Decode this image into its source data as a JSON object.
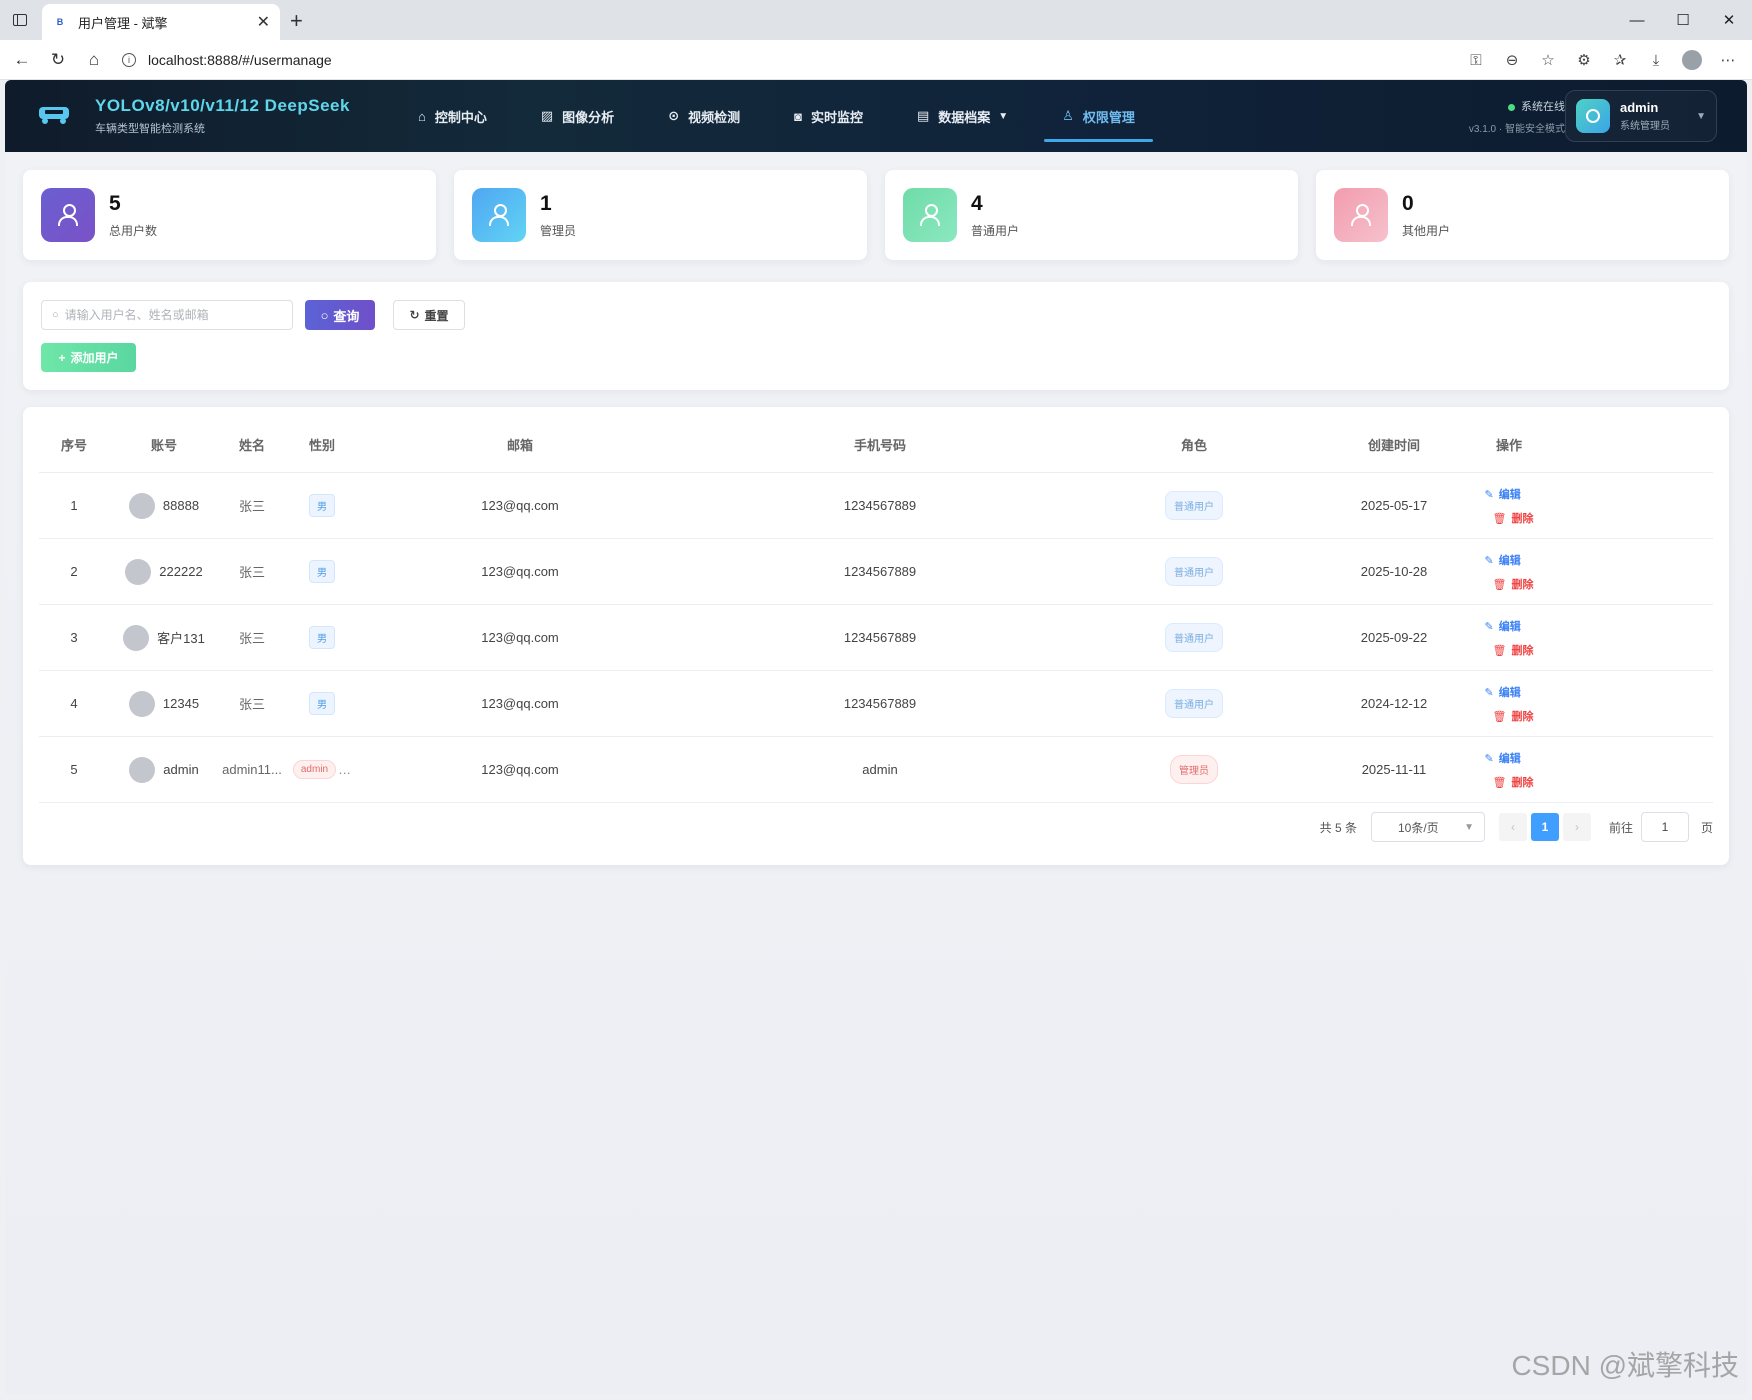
{
  "browser": {
    "tab_title": "用户管理 - 斌擎",
    "tab_favicon": "B",
    "url": "localhost:8888/#/usermanage"
  },
  "header": {
    "title": "YOLOv8/v10/v11/12 DeepSeek",
    "subtitle": "车辆类型智能检测系统",
    "nav": [
      {
        "label": "控制中心",
        "icon": "home-icon"
      },
      {
        "label": "图像分析",
        "icon": "image-icon"
      },
      {
        "label": "视频检测",
        "icon": "play-circle-icon"
      },
      {
        "label": "实时监控",
        "icon": "camera-icon"
      },
      {
        "label": "数据档案",
        "icon": "document-icon"
      },
      {
        "label": "权限管理",
        "icon": "user-icon",
        "active": true
      }
    ],
    "status": "系统在线",
    "version": "v3.1.0 · 智能安全模式",
    "user": {
      "name": "admin",
      "role": "系统管理员"
    }
  },
  "stats": [
    {
      "value": "5",
      "label": "总用户数",
      "color": "#6a5fd1"
    },
    {
      "value": "1",
      "label": "管理员",
      "color": "#4fb8f0"
    },
    {
      "value": "4",
      "label": "普通用户",
      "color": "#6fdca8"
    },
    {
      "value": "0",
      "label": "其他用户",
      "color": "#f2a6b7"
    }
  ],
  "search": {
    "placeholder": "请输入用户名、姓名或邮箱",
    "query_label": "查询",
    "reset_label": "重置",
    "add_label": "添加用户"
  },
  "table": {
    "columns": [
      "序号",
      "账号",
      "姓名",
      "性别",
      "邮箱",
      "手机号码",
      "角色",
      "创建时间",
      "操作"
    ],
    "rows": [
      {
        "idx": "1",
        "account": "88888",
        "name": "张三",
        "sex": "男",
        "email": "123@qq.com",
        "phone": "1234567889",
        "role": "普通用户",
        "created": "2025-05-17"
      },
      {
        "idx": "2",
        "account": "222222",
        "name": "张三",
        "sex": "男",
        "email": "123@qq.com",
        "phone": "1234567889",
        "role": "普通用户",
        "created": "2025-10-28"
      },
      {
        "idx": "3",
        "account": "客户131",
        "name": "张三",
        "sex": "男",
        "email": "123@qq.com",
        "phone": "1234567889",
        "role": "普通用户",
        "created": "2025-09-22"
      },
      {
        "idx": "4",
        "account": "12345",
        "name": "张三",
        "sex": "男",
        "email": "123@qq.com",
        "phone": "1234567889",
        "role": "普通用户",
        "created": "2024-12-12"
      },
      {
        "idx": "5",
        "account": "admin",
        "name": "admin11...",
        "sex": "admin",
        "email": "123@qq.com",
        "phone": "admin",
        "role": "管理员",
        "created": "2025-11-11"
      }
    ],
    "edit_label": "编辑",
    "delete_label": "删除"
  },
  "pagination": {
    "total": "共 5 条",
    "page_size": "10条/页",
    "current": "1",
    "goto_label": "前往",
    "goto_value": "1",
    "page_suffix": "页"
  },
  "watermark": "CSDN @斌擎科技"
}
